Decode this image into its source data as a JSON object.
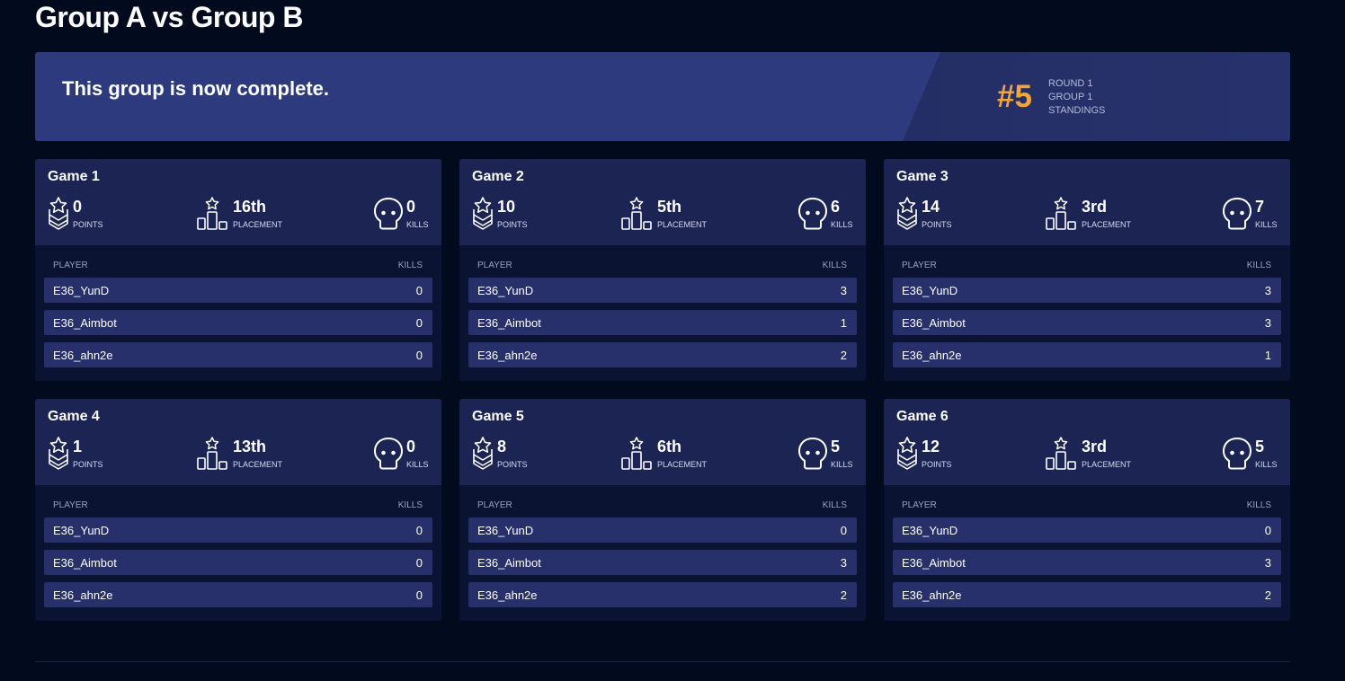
{
  "page": {
    "title": "Group A vs Group B"
  },
  "banner": {
    "message": "This group is now complete.",
    "rank": "#5",
    "round": "ROUND 1",
    "group": "GROUP 1",
    "standings": "STANDINGS"
  },
  "labels": {
    "points": "POINTS",
    "placement": "PLACEMENT",
    "kills": "KILLS",
    "player_col": "PLAYER",
    "kills_col": "KILLS"
  },
  "colors": {
    "accent": "#f6a43a",
    "background": "#020a1d",
    "banner": "#2d3a7e",
    "card_header": "#1c2454",
    "row": "#27306a"
  },
  "icons": {
    "points": "chevron-star-icon",
    "placement": "podium-icon",
    "kills": "skull-icon"
  },
  "games": [
    {
      "title": "Game 1",
      "points": "0",
      "placement": "16th",
      "kills": "0",
      "players": [
        {
          "name": "E36_YunD",
          "kills": "0"
        },
        {
          "name": "E36_Aimbot",
          "kills": "0"
        },
        {
          "name": "E36_ahn2e",
          "kills": "0"
        }
      ]
    },
    {
      "title": "Game 2",
      "points": "10",
      "placement": "5th",
      "kills": "6",
      "players": [
        {
          "name": "E36_YunD",
          "kills": "3"
        },
        {
          "name": "E36_Aimbot",
          "kills": "1"
        },
        {
          "name": "E36_ahn2e",
          "kills": "2"
        }
      ]
    },
    {
      "title": "Game 3",
      "points": "14",
      "placement": "3rd",
      "kills": "7",
      "players": [
        {
          "name": "E36_YunD",
          "kills": "3"
        },
        {
          "name": "E36_Aimbot",
          "kills": "3"
        },
        {
          "name": "E36_ahn2e",
          "kills": "1"
        }
      ]
    },
    {
      "title": "Game 4",
      "points": "1",
      "placement": "13th",
      "kills": "0",
      "players": [
        {
          "name": "E36_YunD",
          "kills": "0"
        },
        {
          "name": "E36_Aimbot",
          "kills": "0"
        },
        {
          "name": "E36_ahn2e",
          "kills": "0"
        }
      ]
    },
    {
      "title": "Game 5",
      "points": "8",
      "placement": "6th",
      "kills": "5",
      "players": [
        {
          "name": "E36_YunD",
          "kills": "0"
        },
        {
          "name": "E36_Aimbot",
          "kills": "3"
        },
        {
          "name": "E36_ahn2e",
          "kills": "2"
        }
      ]
    },
    {
      "title": "Game 6",
      "points": "12",
      "placement": "3rd",
      "kills": "5",
      "players": [
        {
          "name": "E36_YunD",
          "kills": "0"
        },
        {
          "name": "E36_Aimbot",
          "kills": "3"
        },
        {
          "name": "E36_ahn2e",
          "kills": "2"
        }
      ]
    }
  ]
}
